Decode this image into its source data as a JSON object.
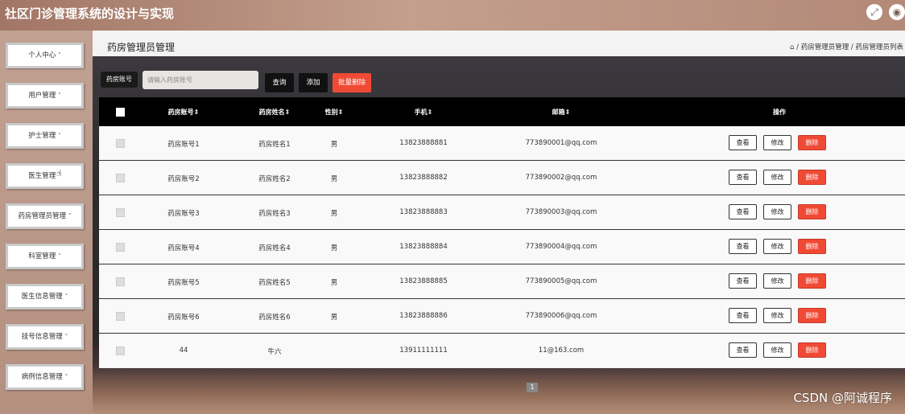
{
  "app": {
    "title": "社区门诊管理系统的设计与实现",
    "icons": {
      "fullscreen": "expand-icon",
      "user": "user-icon"
    }
  },
  "sidebar": {
    "items": [
      {
        "label": "个人中心"
      },
      {
        "label": "用户管理"
      },
      {
        "label": "护士管理"
      },
      {
        "label": "医生管理"
      },
      {
        "label": "药房管理员管理"
      },
      {
        "label": "科室管理"
      },
      {
        "label": "医生信息管理"
      },
      {
        "label": "挂号信息管理"
      },
      {
        "label": "病例信息管理"
      }
    ],
    "caret": "˅"
  },
  "page": {
    "title": "药房管理员管理",
    "breadcrumb": "⌂ / 药房管理员管理 / 药房管理员列表"
  },
  "search": {
    "label": "药房账号",
    "placeholder": "请输入药房账号",
    "query_btn": "查询",
    "add_btn": "添加",
    "batch_delete_btn": "批量删除"
  },
  "table": {
    "headers": [
      "药房账号⇕",
      "药房姓名⇕",
      "性别⇕",
      "手机⇕",
      "邮箱⇕",
      "操作"
    ],
    "rows": [
      {
        "account": "药房账号1",
        "name": "药房姓名1",
        "gender": "男",
        "phone": "13823888881",
        "email": "773890001@qq.com"
      },
      {
        "account": "药房账号2",
        "name": "药房姓名2",
        "gender": "男",
        "phone": "13823888882",
        "email": "773890002@qq.com"
      },
      {
        "account": "药房账号3",
        "name": "药房姓名3",
        "gender": "男",
        "phone": "13823888883",
        "email": "773890003@qq.com"
      },
      {
        "account": "药房账号4",
        "name": "药房姓名4",
        "gender": "男",
        "phone": "13823888884",
        "email": "773890004@qq.com"
      },
      {
        "account": "药房账号5",
        "name": "药房姓名5",
        "gender": "男",
        "phone": "13823888885",
        "email": "773890005@qq.com"
      },
      {
        "account": "药房账号6",
        "name": "药房姓名6",
        "gender": "男",
        "phone": "13823888886",
        "email": "773890006@qq.com"
      },
      {
        "account": "44",
        "name": "牛六",
        "gender": "",
        "phone": "13911111111",
        "email": "11@163.com"
      }
    ],
    "actions": {
      "view": "查看",
      "edit": "修改",
      "delete": "删除"
    }
  },
  "pagination": {
    "current": "1"
  },
  "colors": {
    "delete_red": "#f04a35",
    "header_bg": "#000000"
  },
  "watermark": "CSDN @阿诚程序"
}
